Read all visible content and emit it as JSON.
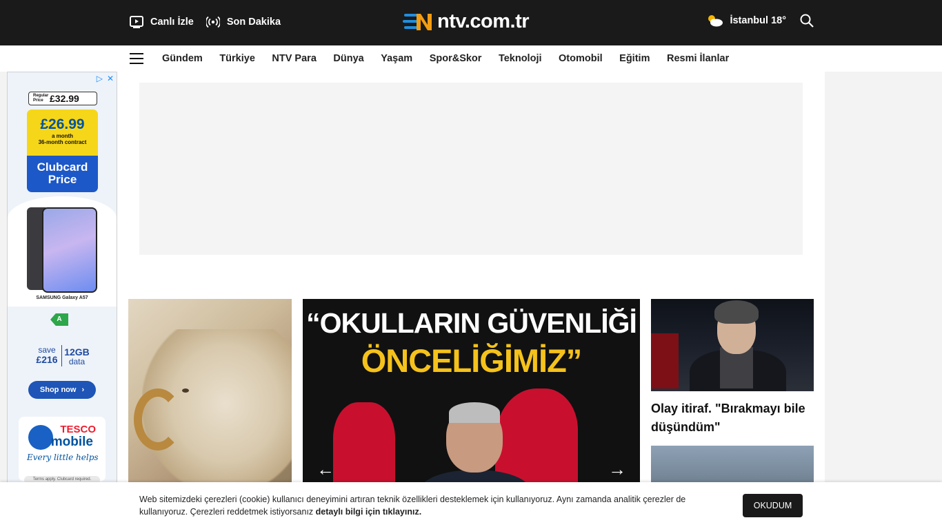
{
  "header": {
    "live_label": "Canlı İzle",
    "breaking_label": "Son Dakika",
    "logo_text": "ntv.com.tr",
    "weather_text": "İstanbul 18°"
  },
  "nav": {
    "items": [
      "Gündem",
      "Türkiye",
      "NTV Para",
      "Dünya",
      "Yaşam",
      "Spor&Skor",
      "Teknoloji",
      "Otomobil",
      "Eğitim",
      "Resmi İlanlar"
    ]
  },
  "side_ad": {
    "regular_label": "Regular Price",
    "regular_price": "£32.99",
    "clubcard_price": "£26.99",
    "clubcard_sub1": "a month",
    "clubcard_sub2": "36-month contract",
    "clubcard_label": "Clubcard Price",
    "phone_brand": "SAMSUNG Galaxy A57",
    "energy_class": "A",
    "save_label": "save",
    "save_amount": "£216",
    "data_amount": "12GB",
    "data_label": "data",
    "shop_label": "Shop now",
    "tesco_word": "TESCO",
    "mobile_word": "mobile",
    "tagline": "Every little helps",
    "terms": "Terms apply. Clubcard required."
  },
  "slider": {
    "headline_line1": "“OKULLARIN GÜVENLİĞİ",
    "headline_line2": "ÖNCELİĞİMİZ”",
    "prev": "←",
    "next": "→"
  },
  "right_card": {
    "title": "Olay itiraf. \"Bırakmayı bile düşündüm\""
  },
  "cookie": {
    "text": "Web sitemizdeki çerezleri (cookie) kullanıcı deneyimini artıran teknik özellikleri desteklemek için kullanıyoruz. Aynı zamanda analitik çerezler de kullanıyoruz. Çerezleri reddetmek istiyorsanız ",
    "link": "detaylı bilgi için tıklayınız.",
    "button": "OKUDUM"
  },
  "colors": {
    "topbar": "#1a1a1a",
    "logo_blue": "#1e8fe0",
    "logo_orange": "#f39c12",
    "headline_yellow": "#f5c21b"
  }
}
